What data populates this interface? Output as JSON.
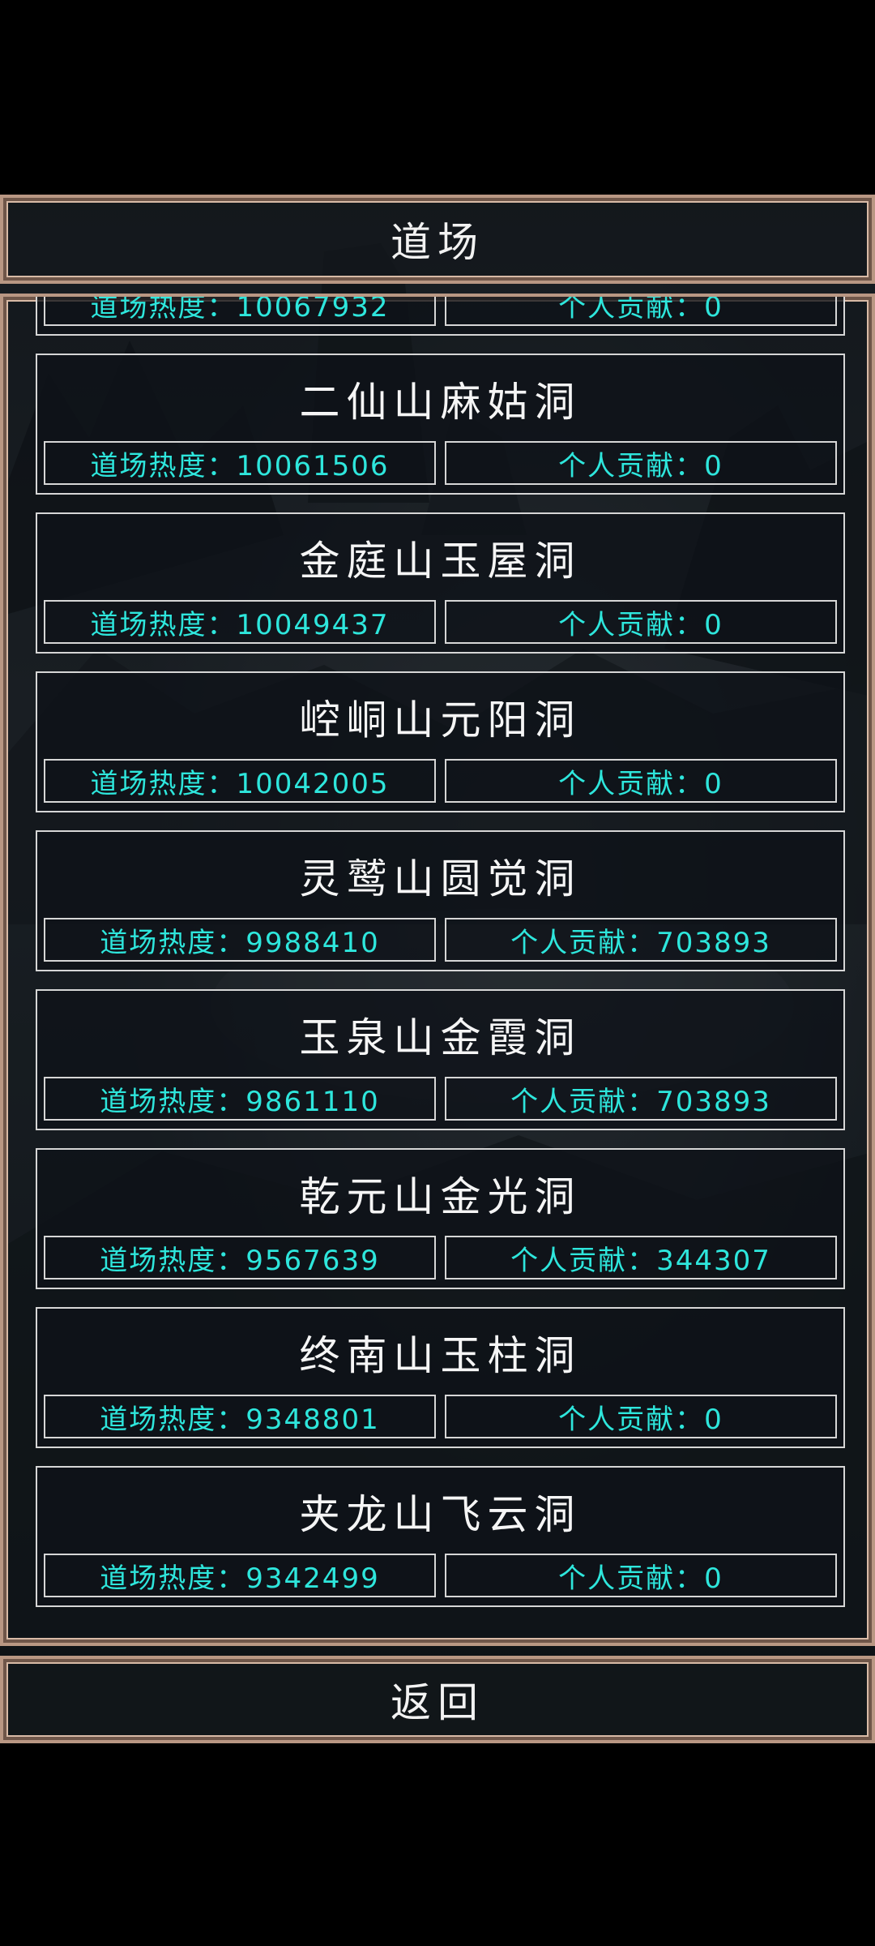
{
  "header": {
    "title": "道场"
  },
  "footer": {
    "back_label": "返回"
  },
  "labels": {
    "heat": "道场热度：",
    "contrib": "个人贡献："
  },
  "dojo_list": [
    {
      "name": "",
      "heat": "道场热度：10067932",
      "contrib": "个人贡献：0"
    },
    {
      "name": "二仙山麻姑洞",
      "heat": "道场热度：10061506",
      "contrib": "个人贡献：0"
    },
    {
      "name": "金庭山玉屋洞",
      "heat": "道场热度：10049437",
      "contrib": "个人贡献：0"
    },
    {
      "name": "崆峒山元阳洞",
      "heat": "道场热度：10042005",
      "contrib": "个人贡献：0"
    },
    {
      "name": "灵鹫山圆觉洞",
      "heat": "道场热度：9988410",
      "contrib": "个人贡献：703893"
    },
    {
      "name": "玉泉山金霞洞",
      "heat": "道场热度：9861110",
      "contrib": "个人贡献：703893"
    },
    {
      "name": "乾元山金光洞",
      "heat": "道场热度：9567639",
      "contrib": "个人贡献：344307"
    },
    {
      "name": "终南山玉柱洞",
      "heat": "道场热度：9348801",
      "contrib": "个人贡献：0"
    },
    {
      "name": "夹龙山飞云洞",
      "heat": "道场热度：9342499",
      "contrib": "个人贡献：0"
    }
  ],
  "colors": {
    "frame": "#b99783",
    "stat_text": "#2ee6dc",
    "title_text": "#f2f2f2"
  }
}
